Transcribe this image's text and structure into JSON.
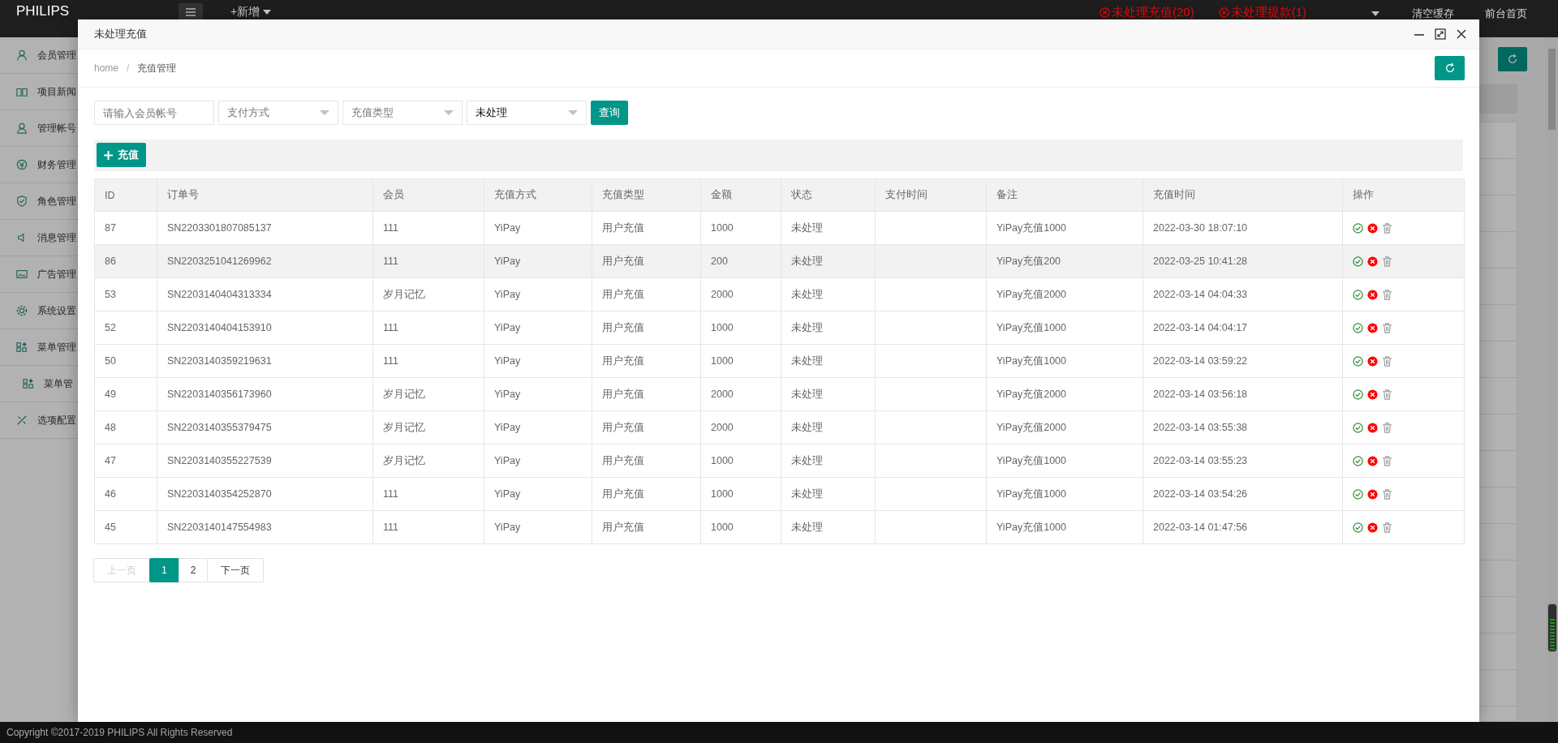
{
  "top_bar": {
    "logo": "PHILIPS",
    "new_menu": "+新增",
    "alerts": [
      {
        "label": "未处理充值(20)"
      },
      {
        "label": "未处理提款(1)"
      }
    ],
    "links": [
      "清空缓存",
      "前台首页"
    ]
  },
  "sidebar": {
    "items": [
      {
        "label": "会员管理"
      },
      {
        "label": "项目新闻"
      },
      {
        "label": "管理帐号"
      },
      {
        "label": "财务管理"
      },
      {
        "label": "角色管理"
      },
      {
        "label": "消息管理"
      },
      {
        "label": "广告管理"
      },
      {
        "label": "系统设置"
      },
      {
        "label": "菜单管理",
        "children": [
          {
            "label": "菜单管"
          }
        ]
      },
      {
        "label": "选项配置"
      }
    ]
  },
  "modal": {
    "title": "未处理充值",
    "breadcrumb": [
      "home",
      "充值管理"
    ],
    "breadcrumb_separator": "/",
    "filters": {
      "member_placeholder": "请输入会员帐号",
      "selects": [
        {
          "placeholder": "支付方式"
        },
        {
          "placeholder": "充值类型"
        },
        {
          "value": "未处理"
        }
      ],
      "query_button": "查询"
    },
    "add_button": "充值",
    "table": {
      "columns": [
        "ID",
        "订单号",
        "会员",
        "充值方式",
        "充值类型",
        "金额",
        "状态",
        "支付时间",
        "备注",
        "充值时间",
        "操作"
      ],
      "rows": [
        {
          "id": "87",
          "order_no": "SN2203301807085137",
          "member": "111",
          "method": "YiPay",
          "type": "用户充值",
          "amount": "1000",
          "status": "未处理",
          "note": "YiPay充值1000",
          "time": "2022-03-30 18:07:10",
          "selected": false
        },
        {
          "id": "86",
          "order_no": "SN2203251041269962",
          "member": "111",
          "method": "YiPay",
          "type": "用户充值",
          "amount": "200",
          "status": "未处理",
          "note": "YiPay充值200",
          "time": "2022-03-25 10:41:28",
          "selected": true
        },
        {
          "id": "53",
          "order_no": "SN2203140404313334",
          "member": "岁月记忆",
          "method": "YiPay",
          "type": "用户充值",
          "amount": "2000",
          "status": "未处理",
          "note": "YiPay充值2000",
          "time": "2022-03-14 04:04:33",
          "selected": false
        },
        {
          "id": "52",
          "order_no": "SN2203140404153910",
          "member": "111",
          "method": "YiPay",
          "type": "用户充值",
          "amount": "1000",
          "status": "未处理",
          "note": "YiPay充值1000",
          "time": "2022-03-14 04:04:17",
          "selected": false
        },
        {
          "id": "50",
          "order_no": "SN2203140359219631",
          "member": "111",
          "method": "YiPay",
          "type": "用户充值",
          "amount": "1000",
          "status": "未处理",
          "note": "YiPay充值1000",
          "time": "2022-03-14 03:59:22",
          "selected": false
        },
        {
          "id": "49",
          "order_no": "SN2203140356173960",
          "member": "岁月记忆",
          "method": "YiPay",
          "type": "用户充值",
          "amount": "2000",
          "status": "未处理",
          "note": "YiPay充值2000",
          "time": "2022-03-14 03:56:18",
          "selected": false
        },
        {
          "id": "48",
          "order_no": "SN2203140355379475",
          "member": "岁月记忆",
          "method": "YiPay",
          "type": "用户充值",
          "amount": "2000",
          "status": "未处理",
          "note": "YiPay充值2000",
          "time": "2022-03-14 03:55:38",
          "selected": false
        },
        {
          "id": "47",
          "order_no": "SN2203140355227539",
          "member": "岁月记忆",
          "method": "YiPay",
          "type": "用户充值",
          "amount": "1000",
          "status": "未处理",
          "note": "YiPay充值1000",
          "time": "2022-03-14 03:55:23",
          "selected": false
        },
        {
          "id": "46",
          "order_no": "SN2203140354252870",
          "member": "111",
          "method": "YiPay",
          "type": "用户充值",
          "amount": "1000",
          "status": "未处理",
          "note": "YiPay充值1000",
          "time": "2022-03-14 03:54:26",
          "selected": false
        },
        {
          "id": "45",
          "order_no": "SN2203140147554983",
          "member": "111",
          "method": "YiPay",
          "type": "用户充值",
          "amount": "1000",
          "status": "未处理",
          "note": "YiPay充值1000",
          "time": "2022-03-14 01:47:56",
          "selected": false
        }
      ]
    },
    "pagination": [
      {
        "label": "上一页",
        "kind": "prev",
        "selected": false,
        "disabled": true
      },
      {
        "label": "1",
        "kind": "page",
        "selected": true,
        "disabled": false
      },
      {
        "label": "2",
        "kind": "page",
        "selected": false,
        "disabled": false
      },
      {
        "label": "下一页",
        "kind": "next",
        "selected": false,
        "disabled": false
      }
    ]
  },
  "footer": "Copyright ©2017-2019 PHILIPS All Rights Reserved"
}
